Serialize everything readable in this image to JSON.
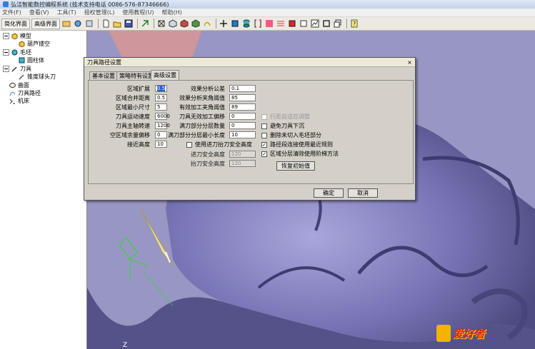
{
  "window": {
    "title": "弘洁智能数控编程系统 (技术支持电话 0086-576-87346666)"
  },
  "menu": [
    "文件(F)",
    "查看(V)",
    "工具(T)",
    "授权管理(L)",
    "使用教程(U)",
    "帮助(H)"
  ],
  "toolbar": {
    "simple_label": "简化界面",
    "advanced_label": "高级界面"
  },
  "tree": {
    "model": "模型",
    "model_child": "葫芦镂空",
    "blank": "毛坯",
    "blank_child": "圆柱体",
    "tool": "刀具",
    "tool_child": "锥度球头刀",
    "surface": "曲面",
    "toolpath": "刀具路径",
    "machine": "机床"
  },
  "viewport": {
    "axis_label": "Z"
  },
  "dialog": {
    "title": "刀具路径设置",
    "close": "×",
    "tabs": [
      {
        "label": "基本设置"
      },
      {
        "label": "策略特有设置"
      },
      {
        "label": "高级设置"
      }
    ],
    "left_fields": [
      {
        "label": "区域扩展",
        "value": "0.5"
      },
      {
        "label": "区域合并距离",
        "value": "0.5"
      },
      {
        "label": "区域最小尺寸",
        "value": "5"
      },
      {
        "label": "刀具运动速度",
        "value": "6000"
      },
      {
        "label": "刀具主轴转速",
        "value": "1200"
      },
      {
        "label": "空区域余量偏移",
        "value": "0"
      },
      {
        "label": "接近高度",
        "value": "10"
      }
    ],
    "mid_fields": [
      {
        "label": "效果分析公差",
        "value": "0.1"
      },
      {
        "label": "效果分析夹角阈值",
        "value": "85"
      },
      {
        "label": "有效加工夹角阈值",
        "value": "89"
      },
      {
        "label": "刀具无效加工偏移",
        "value": "0"
      },
      {
        "label": "满刀部分分层数量",
        "value": "0"
      },
      {
        "label": "满刀部分分层最小长度",
        "value": "10"
      }
    ],
    "safety": {
      "checkbox_label": "使用进刀抬刀安全高度",
      "fields": [
        {
          "label": "进刀安全高度",
          "value": "120"
        },
        {
          "label": "抬刀安全高度",
          "value": "120"
        }
      ]
    },
    "right_checks": [
      {
        "label": "行距自适应调整",
        "checked": false,
        "disabled": true,
        "mark": ""
      },
      {
        "label": "避免刀具下沉",
        "checked": false,
        "disabled": false,
        "mark": ""
      },
      {
        "label": "删除未切入毛坯部分",
        "checked": false,
        "disabled": false,
        "mark": ""
      },
      {
        "label": "路径段连接使用最近规则",
        "checked": true,
        "disabled": false,
        "mark": "✓"
      },
      {
        "label": "区域分层清除使用阶梯方法",
        "checked": true,
        "disabled": false,
        "mark": "✓"
      }
    ],
    "restore_label": "恢复初始值",
    "ok_label": "确定",
    "cancel_label": "取消"
  },
  "watermark": {
    "text": "爱好者"
  }
}
